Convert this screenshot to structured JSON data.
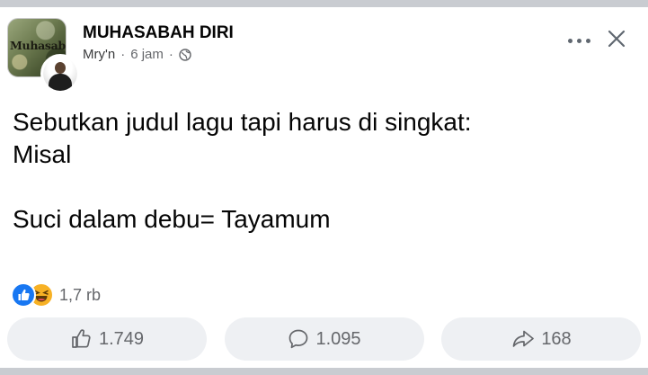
{
  "post": {
    "page_name": "MUHASABAH DIRI",
    "page_logo_text": "Muhasabah",
    "author": "Mry'n",
    "time": "6 jam",
    "separator": "·",
    "privacy_icon": "globe-icon",
    "content": {
      "line1": "Sebutkan judul lagu tapi harus di singkat:",
      "line2": "Misal",
      "line3": "Suci dalam debu= Tayamum"
    },
    "reactions": {
      "icons": [
        "like-reaction-icon",
        "haha-reaction-icon"
      ],
      "count": "1,7 rb"
    },
    "actions": {
      "like_count": "1.749",
      "comment_count": "1.095",
      "share_count": "168"
    }
  },
  "colors": {
    "background": "#c9ccd1",
    "card": "#ffffff",
    "secondary_text": "#65676b",
    "like_blue": "#1877f2",
    "haha_yellow": "#f7b125",
    "action_bg": "#eef0f3"
  }
}
